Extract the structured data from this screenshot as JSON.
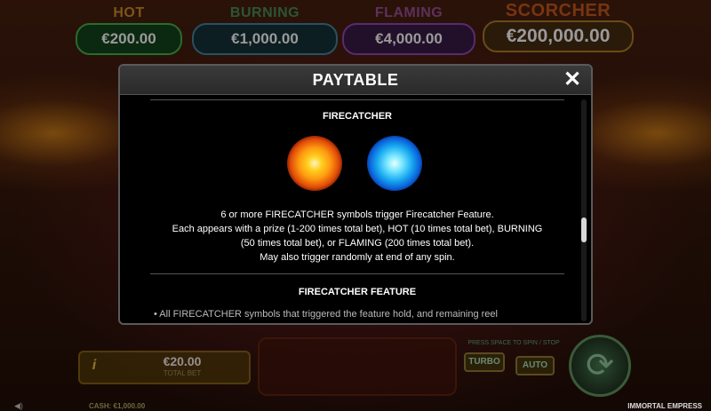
{
  "jackpots": [
    {
      "name": "HOT",
      "value": "€200.00"
    },
    {
      "name": "BURNING",
      "value": "€1,000.00"
    },
    {
      "name": "FLAMING",
      "value": "€4,000.00"
    },
    {
      "name": "SCORCHER",
      "value": "€200,000.00"
    }
  ],
  "modal": {
    "title": "PAYTABLE",
    "close_icon": "close-icon",
    "section1_title": "FIRECATCHER",
    "symbols": [
      "fire-orb-icon",
      "blue-orb-icon"
    ],
    "description": [
      "6 or more FIRECATCHER symbols trigger Firecatcher Feature.",
      "Each appears with a prize (1-200 times total bet), HOT (10 times total bet), BURNING",
      "(50 times total bet), or FLAMING (200 times total bet).",
      "May also trigger randomly at end of any spin."
    ],
    "section2_title": "FIRECATCHER FEATURE",
    "bullet": "• All FIRECATCHER symbols that triggered the feature hold, and remaining reel",
    "scroll_position": 0.6
  },
  "bottom": {
    "info_label": "i",
    "bet_value": "€20.00",
    "bet_label": "TOTAL BET",
    "autostop_label": "PRESS SPACE TO SPIN / STOP",
    "turbo_label": "TURBO",
    "auto_label": "AUTO",
    "spin_icon": "spin-icon"
  },
  "status": {
    "sound_icon": "speaker-icon",
    "cash": "CASH: €1,000.00",
    "game_name": "IMMORTAL EMPRESS"
  }
}
